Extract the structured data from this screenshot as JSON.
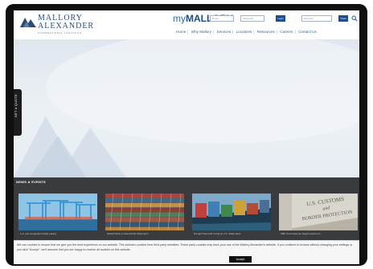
{
  "header": {
    "logo": {
      "line1": "MALLORY",
      "line2": "ALEXANDER",
      "tagline": "INTERNATIONAL LOGISTICS"
    },
    "portal": {
      "prefix": "my",
      "brand": "MALLORY"
    },
    "email_placeholder": "Email",
    "password_placeholder": "Password",
    "login_label": "Login",
    "search_placeholder": "Example",
    "track_label": "Track"
  },
  "nav": {
    "items": [
      "Home",
      "Why Mallory",
      "Services",
      "Locations",
      "Resources",
      "Careers",
      "Contact Us"
    ]
  },
  "side_tab": {
    "label": "GET A QUOTE"
  },
  "news": {
    "heading": "NEWS & EVENTS",
    "cards": [
      {
        "caption": "L.A. port congestion finally easing",
        "image": "port-cranes"
      },
      {
        "caption": "Global News in Asia-Pacific Shipments",
        "image": "container-yard"
      },
      {
        "caption": "Drought Sea Gulf of Fuji at U.S. dollar index",
        "image": "container-ship"
      },
      {
        "caption": "CBP Commissioner begins launch of...",
        "image": "customs-sign"
      }
    ]
  },
  "customs_sign": {
    "line1": "U.S. CUSTOMS",
    "line2": "and",
    "line3": "BORDER PROTECTION"
  },
  "cookie": {
    "text": "We use cookies to ensure that we give you the best experience on our website. This includes cookies from third party websites. These party cookies may track your use of the Mallory Alexander's website. If you continue to browse without changing your settings or you click \"Accept\", we'll assume that you are happy to receive all cookies on this website.",
    "accept_label": "Accept"
  },
  "colors": {
    "brand": "#1e4c8a",
    "dark_band": "#3a3b3f"
  }
}
